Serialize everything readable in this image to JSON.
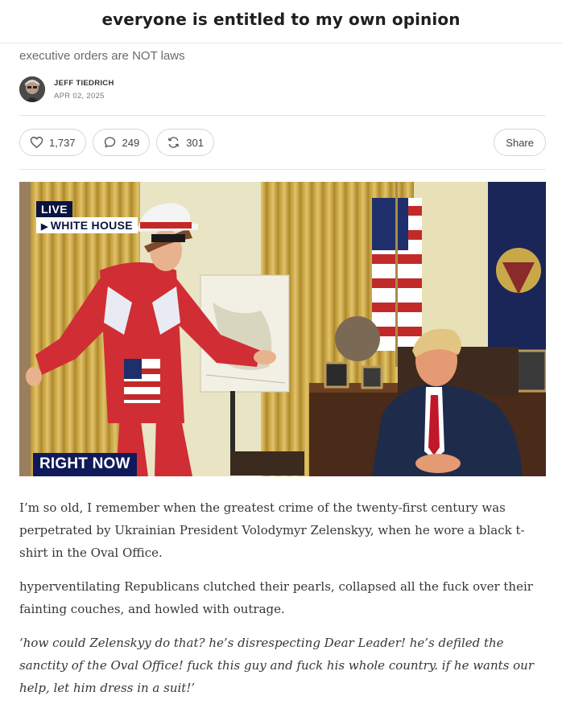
{
  "header": {
    "publication_title": "everyone is entitled to my own opinion"
  },
  "post": {
    "subtitle": "executive orders are NOT laws",
    "author": "JEFF TIEDRICH",
    "date": "APR 02, 2025",
    "actions": {
      "likes": "1,737",
      "comments": "249",
      "restacks": "301",
      "share_label": "Share"
    },
    "image": {
      "live_badge": "LIVE",
      "location_badge": "WHITE HOUSE",
      "lower_third": "RIGHT NOW"
    },
    "paragraphs": [
      "I’m so old, I remember when the greatest crime of the twenty-first century was perpetrated by Ukrainian President Volodymyr Zelenskyy, when he wore a black t-shirt in the Oval Office.",
      "hyperventilating Republicans clutched their pearls, collapsed all the fuck over their fainting couches, and howled with outrage.",
      "‘how could Zelenskyy do that? he’s disrespecting Dear Leader! he’s defiled the sanctity of the Oval Office! fuck this guy and fuck his whole country. if he wants our help, let him dress in a suit!’"
    ]
  },
  "icons": [
    "heart-icon",
    "comment-icon",
    "restack-icon"
  ],
  "colors": {
    "badge_navy": "#0b1440",
    "lower_third_navy": "#101a5a"
  }
}
